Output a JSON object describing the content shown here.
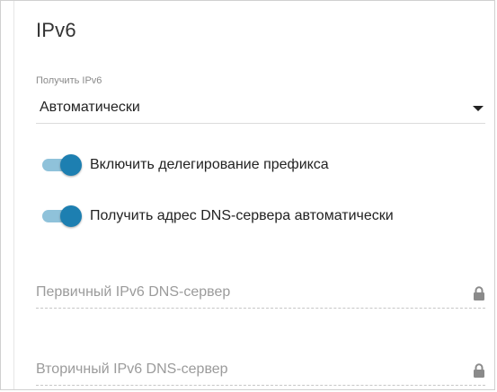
{
  "section": {
    "title": "IPv6"
  },
  "obtain_ipv6": {
    "label": "Получить IPv6",
    "value": "Автоматически",
    "icon": "chevron-down-icon"
  },
  "toggles": [
    {
      "label": "Включить делегирование префикса",
      "on": true
    },
    {
      "label": "Получить адрес DNS-сервера автоматически",
      "on": true
    }
  ],
  "fields": {
    "primary_dns": {
      "placeholder": "Первичный IPv6 DNS-сервер",
      "locked": true,
      "icon": "lock-icon"
    },
    "secondary_dns": {
      "placeholder": "Вторичный IPv6 DNS-сервер",
      "locked": true,
      "icon": "lock-icon"
    }
  },
  "colors": {
    "toggle_knob": "#1d7fb1",
    "toggle_track": "#8fc2da",
    "placeholder": "#9b9b9b"
  }
}
